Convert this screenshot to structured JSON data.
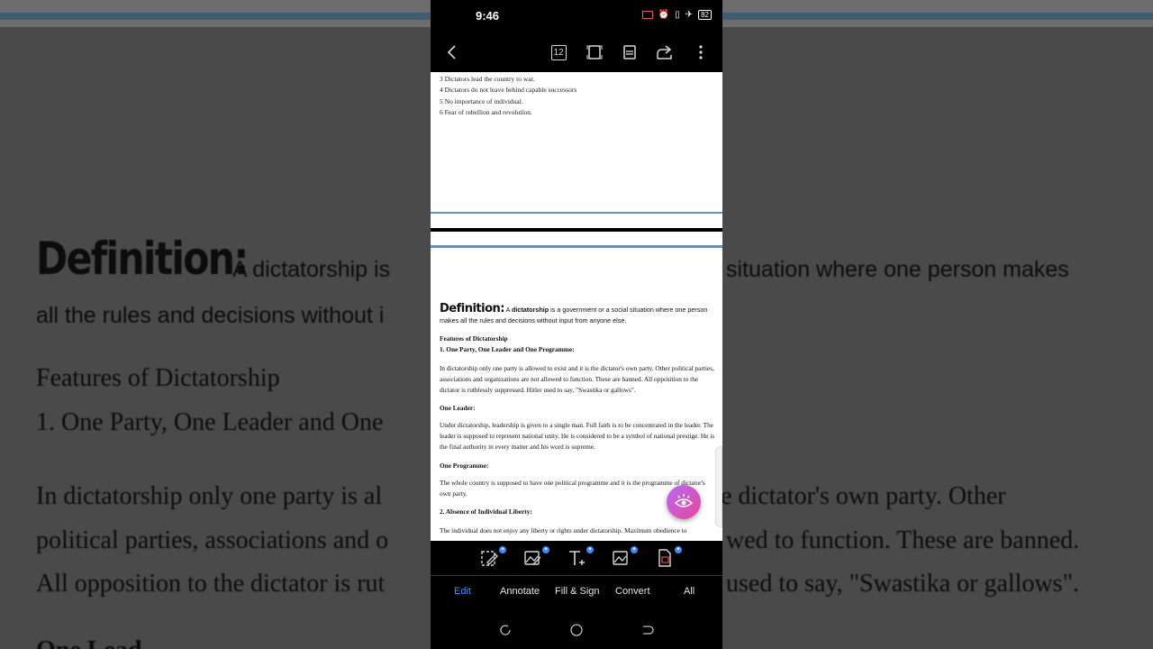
{
  "background": {
    "definition_word": "Definition:",
    "definition_a": "A dictatorship is",
    "definition_rest": "situation where one person makes",
    "definition_line2": "all the rules and decisions without i",
    "features_heading": "Features of Dictatorship",
    "one_party_heading": "1. One Party, One Leader and One",
    "para_line1": "In dictatorship only one party is al",
    "para_line1_right": "e dictator's own party. Other",
    "para_line2": "political parties, associations and o",
    "para_line2_right": "wed to function. These are banned.",
    "para_line3": "All opposition to the dictator is rut",
    "para_line3_right": "used to say, \"Swastika or gallows\".",
    "next_heading": "One Lead"
  },
  "status_bar": {
    "time": "9:46",
    "battery": "82"
  },
  "toolbar": {
    "page_number": "12"
  },
  "document": {
    "page1_lines": [
      "3 Dictators lead the country to war.",
      "4 Dictators do not leave behind capable successors",
      "5 No importance of individual.",
      "6 Fear of rebellion and revolution."
    ],
    "definition_word": "Definition:",
    "definition_a": "A",
    "definition_bold": "dictatorship",
    "definition_rest": "is a government or a social situation where one person makes all the rules and decisions without input from anyone else.",
    "features_heading": "Features of Dictatorship",
    "one_party_heading": "1. One Party, One Leader and One Programme:",
    "one_party_text": "In dictatorship only one party is allowed to exist and it is the dictator's own party. Other political parties, associations and organizations are not allowed to function. These are banned. All opposition to the dictator is ruthlessly suppressed. Hitler used to say, \"Swastika or gallows\".",
    "one_leader_heading": "One Leader:",
    "one_leader_text": "Under dictatorship, leadership is given to a single man. Full faith is to be concentrated in the leader. The leader is supposed to represent national unity. He is considered to be a symbol of national prestige. He is the final authority in every matter and his word is supreme.",
    "one_programme_heading": "One Programme:",
    "one_programme_text": "The whole country is supposed to have one political programme and it is the programme of dictator's own party.",
    "absence_heading": "2. Absence of Individual Liberty:",
    "absence_text": "The individual does not enjoy any liberty or rights under dictatorship. Maximum obedience to"
  },
  "bottom_tabs": {
    "edit": "Edit",
    "annotate": "Annotate",
    "fill_sign": "Fill & Sign",
    "convert": "Convert",
    "all": "All"
  },
  "colors": {
    "accent": "#4f8ef7",
    "fab_start": "#b76cf2",
    "fab_end": "#e7469c",
    "badge": "#3d8af7"
  },
  "icons": [
    "back-icon",
    "page-number-icon",
    "fit-page-icon",
    "reading-mode-icon",
    "share-icon",
    "more-icon",
    "edit-text-icon",
    "edit-image-icon",
    "add-text-icon",
    "add-image-icon",
    "convert-icon",
    "eye-icon"
  ]
}
